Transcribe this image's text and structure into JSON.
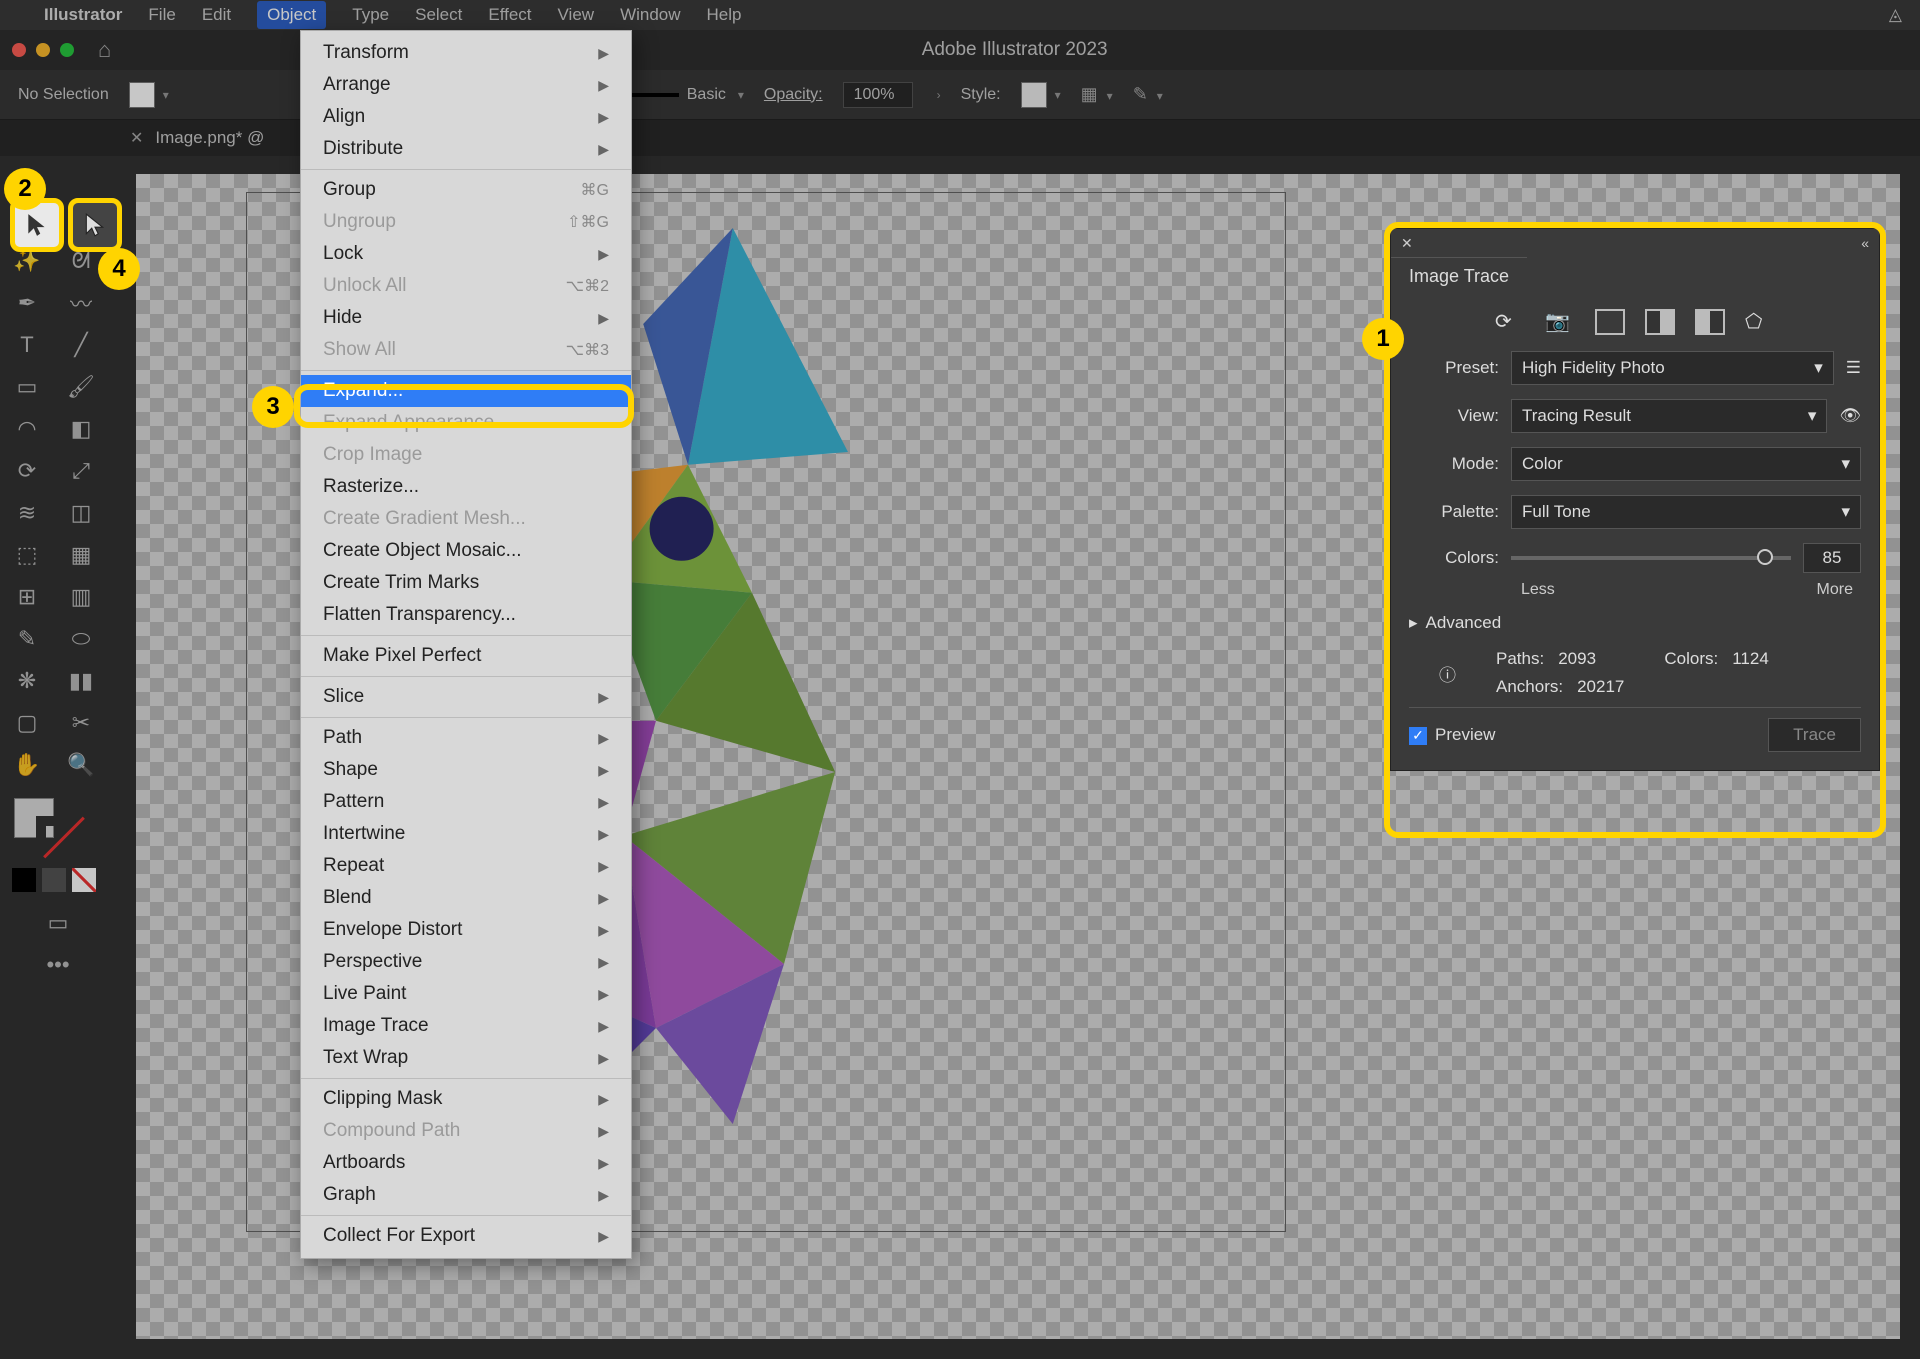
{
  "menubar": {
    "app": "Illustrator",
    "items": [
      "File",
      "Edit",
      "Object",
      "Type",
      "Select",
      "Effect",
      "View",
      "Window",
      "Help"
    ],
    "active_index": 2
  },
  "titlebar": {
    "title": "Adobe Illustrator 2023"
  },
  "controlbar": {
    "selection": "No Selection",
    "stroke_label": "Basic",
    "opacity_label": "Opacity:",
    "opacity_value": "100%",
    "style_label": "Style:"
  },
  "tab": {
    "filename": "Image.png* @"
  },
  "dropdown": {
    "groups": [
      [
        {
          "label": "Transform",
          "sub": true
        },
        {
          "label": "Arrange",
          "sub": true
        },
        {
          "label": "Align",
          "sub": true
        },
        {
          "label": "Distribute",
          "sub": true
        }
      ],
      [
        {
          "label": "Group",
          "shortcut": "⌘G"
        },
        {
          "label": "Ungroup",
          "shortcut": "⇧⌘G",
          "disabled": true
        },
        {
          "label": "Lock",
          "sub": true
        },
        {
          "label": "Unlock All",
          "shortcut": "⌥⌘2",
          "disabled": true
        },
        {
          "label": "Hide",
          "sub": true
        },
        {
          "label": "Show All",
          "shortcut": "⌥⌘3",
          "disabled": true
        }
      ],
      [
        {
          "label": "Expand...",
          "highlighted": true
        },
        {
          "label": "Expand Appearance",
          "disabled": true
        },
        {
          "label": "Crop Image",
          "disabled": true
        },
        {
          "label": "Rasterize..."
        },
        {
          "label": "Create Gradient Mesh...",
          "disabled": true
        },
        {
          "label": "Create Object Mosaic..."
        },
        {
          "label": "Create Trim Marks"
        },
        {
          "label": "Flatten Transparency..."
        }
      ],
      [
        {
          "label": "Make Pixel Perfect"
        }
      ],
      [
        {
          "label": "Slice",
          "sub": true
        }
      ],
      [
        {
          "label": "Path",
          "sub": true
        },
        {
          "label": "Shape",
          "sub": true
        },
        {
          "label": "Pattern",
          "sub": true
        },
        {
          "label": "Intertwine",
          "sub": true
        },
        {
          "label": "Repeat",
          "sub": true
        },
        {
          "label": "Blend",
          "sub": true
        },
        {
          "label": "Envelope Distort",
          "sub": true
        },
        {
          "label": "Perspective",
          "sub": true
        },
        {
          "label": "Live Paint",
          "sub": true
        },
        {
          "label": "Image Trace",
          "sub": true
        },
        {
          "label": "Text Wrap",
          "sub": true
        }
      ],
      [
        {
          "label": "Clipping Mask",
          "sub": true
        },
        {
          "label": "Compound Path",
          "sub": true,
          "disabled": true
        },
        {
          "label": "Artboards",
          "sub": true
        },
        {
          "label": "Graph",
          "sub": true
        }
      ],
      [
        {
          "label": "Collect For Export",
          "sub": true
        }
      ]
    ]
  },
  "panel": {
    "title": "Image Trace",
    "preset_label": "Preset:",
    "preset_value": "High Fidelity Photo",
    "view_label": "View:",
    "view_value": "Tracing Result",
    "mode_label": "Mode:",
    "mode_value": "Color",
    "palette_label": "Palette:",
    "palette_value": "Full Tone",
    "colors_label": "Colors:",
    "colors_value": "85",
    "less": "Less",
    "more": "More",
    "advanced": "Advanced",
    "paths_label": "Paths:",
    "paths_value": "2093",
    "colors_stat_label": "Colors:",
    "colors_stat_value": "1124",
    "anchors_label": "Anchors:",
    "anchors_value": "20217",
    "preview_label": "Preview",
    "trace_label": "Trace"
  },
  "callouts": {
    "c1": "1",
    "c2": "2",
    "c3": "3",
    "c4": "4"
  }
}
